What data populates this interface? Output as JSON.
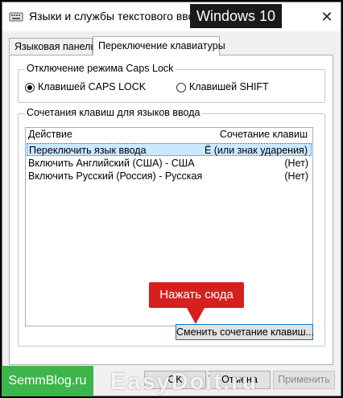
{
  "window": {
    "title": "Языки и службы текстового ввода",
    "os_badge": "Windows 10",
    "close_glyph": "✕"
  },
  "tabs": [
    {
      "label": "Языковая панель",
      "active": false
    },
    {
      "label": "Переключение клавиатуры",
      "active": true
    }
  ],
  "caps_lock": {
    "legend": "Отключение режима Caps Lock",
    "options": [
      {
        "label": "Клавишей CAPS LOCK",
        "checked": true
      },
      {
        "label": "Клавишей SHIFT",
        "checked": false
      }
    ]
  },
  "hotkeys": {
    "legend": "Сочетания клавиш для языков ввода",
    "columns": [
      "Действие",
      "Сочетание клавиш"
    ],
    "rows": [
      {
        "action": "Переключить язык ввода",
        "combo": "Ё (или знак ударения)",
        "selected": true
      },
      {
        "action": "Включить Английский (США) - США",
        "combo": "(Нет)",
        "selected": false
      },
      {
        "action": "Включить Русский (Россия) - Русская",
        "combo": "(Нет)",
        "selected": false
      }
    ],
    "change_button": "Сменить сочетание клавиш..."
  },
  "callout": {
    "text": "Нажать сюда",
    "color": "#d61f1f"
  },
  "buttons": {
    "ok": "OK",
    "cancel": "Отмена",
    "apply": "Применить"
  },
  "watermarks": {
    "left": "SemmBlog.ru",
    "center": "EasyDoit.ru"
  },
  "icons": {
    "app": "keyboard-icon",
    "close": "close-icon"
  },
  "colors": {
    "accent": "#0078d7",
    "selection": "#cce8ff",
    "watermark_green": "#3db54a"
  }
}
